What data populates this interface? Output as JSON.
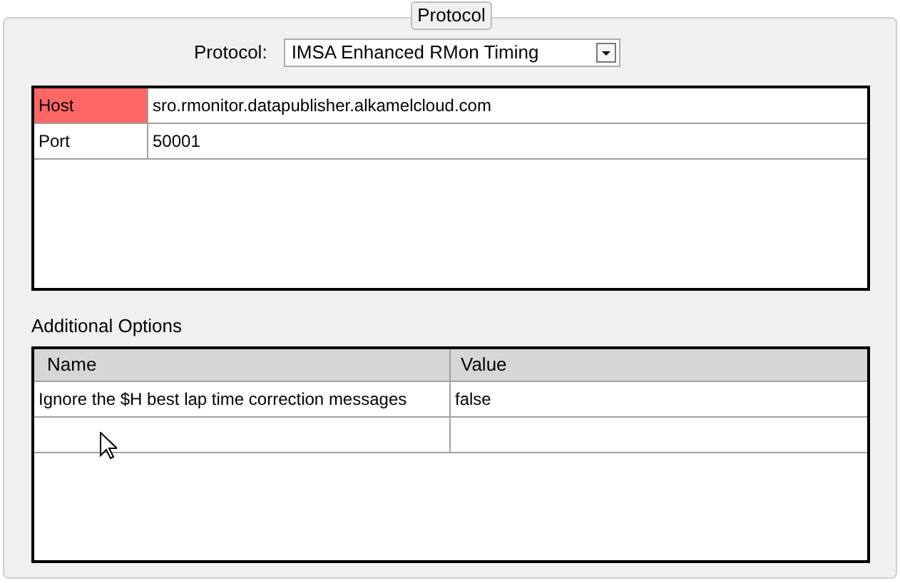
{
  "group": {
    "title": "Protocol"
  },
  "protocol": {
    "label": "Protocol:",
    "value": "IMSA Enhanced RMon Timing"
  },
  "connection": [
    {
      "name": "Host",
      "value": "sro.rmonitor.datapublisher.alkamelcloud.com",
      "error": true
    },
    {
      "name": "Port",
      "value": "50001",
      "error": false
    }
  ],
  "additional_options": {
    "label": "Additional Options",
    "columns": [
      "Name",
      "Value"
    ],
    "rows": [
      {
        "name": "Ignore the $H best lap time correction messages",
        "value": "false"
      }
    ]
  }
}
